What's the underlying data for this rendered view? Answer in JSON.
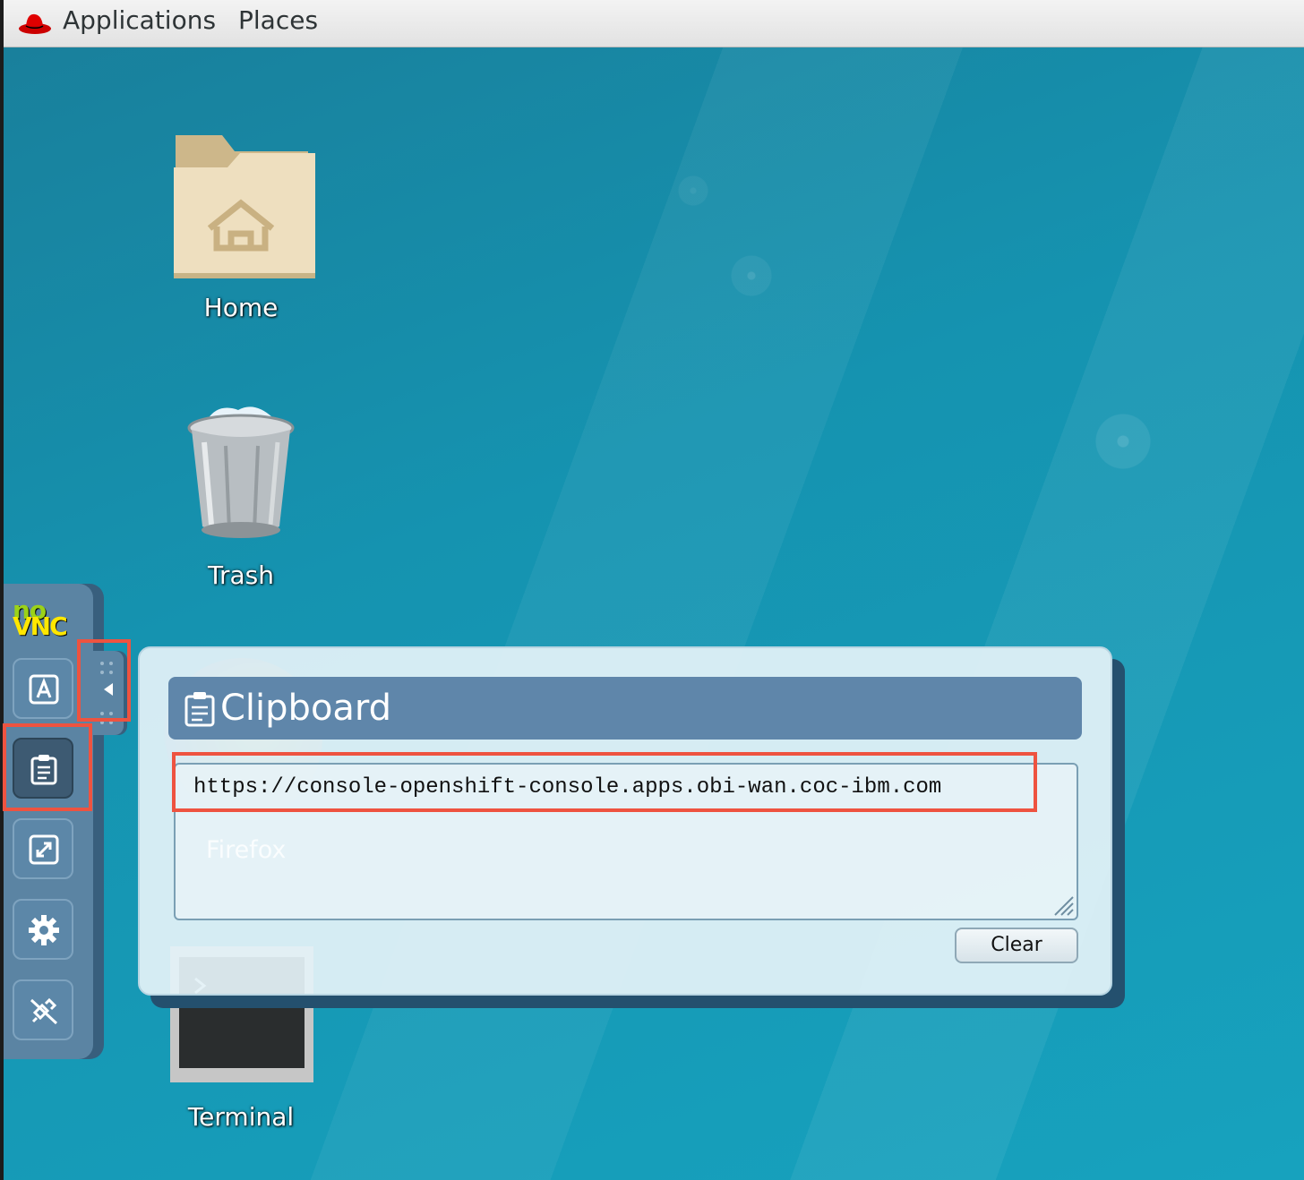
{
  "topbar": {
    "logo_icon": "redhat-icon",
    "applications_label": "Applications",
    "places_label": "Places"
  },
  "desktop": {
    "icons": [
      {
        "label": "Home",
        "icon": "home-folder-icon"
      },
      {
        "label": "Trash",
        "icon": "trash-icon"
      },
      {
        "label": "Firefox",
        "icon": "firefox-icon"
      },
      {
        "label": "Terminal",
        "icon": "terminal-icon"
      }
    ]
  },
  "novnc": {
    "logo_no": "no",
    "logo_vnc": "VNC",
    "buttons": [
      {
        "name": "keyboard",
        "icon": "keyboard-a-icon"
      },
      {
        "name": "clipboard",
        "icon": "clipboard-icon",
        "active": true
      },
      {
        "name": "fullscreen",
        "icon": "fullscreen-icon"
      },
      {
        "name": "settings",
        "icon": "gear-icon"
      },
      {
        "name": "disconnect",
        "icon": "disconnect-icon"
      }
    ],
    "handle_icon": "arrow-left-icon"
  },
  "clipboard": {
    "title": "Clipboard",
    "title_icon": "clipboard-icon",
    "value": "https://console-openshift-console.apps.obi-wan.coc-ibm.com",
    "clear_label": "Clear"
  },
  "colors": {
    "highlight": "#ee5340",
    "panel_header": "#5f86aa",
    "novnc_bar": "#5b84a3",
    "desktop": "#1595b2"
  }
}
